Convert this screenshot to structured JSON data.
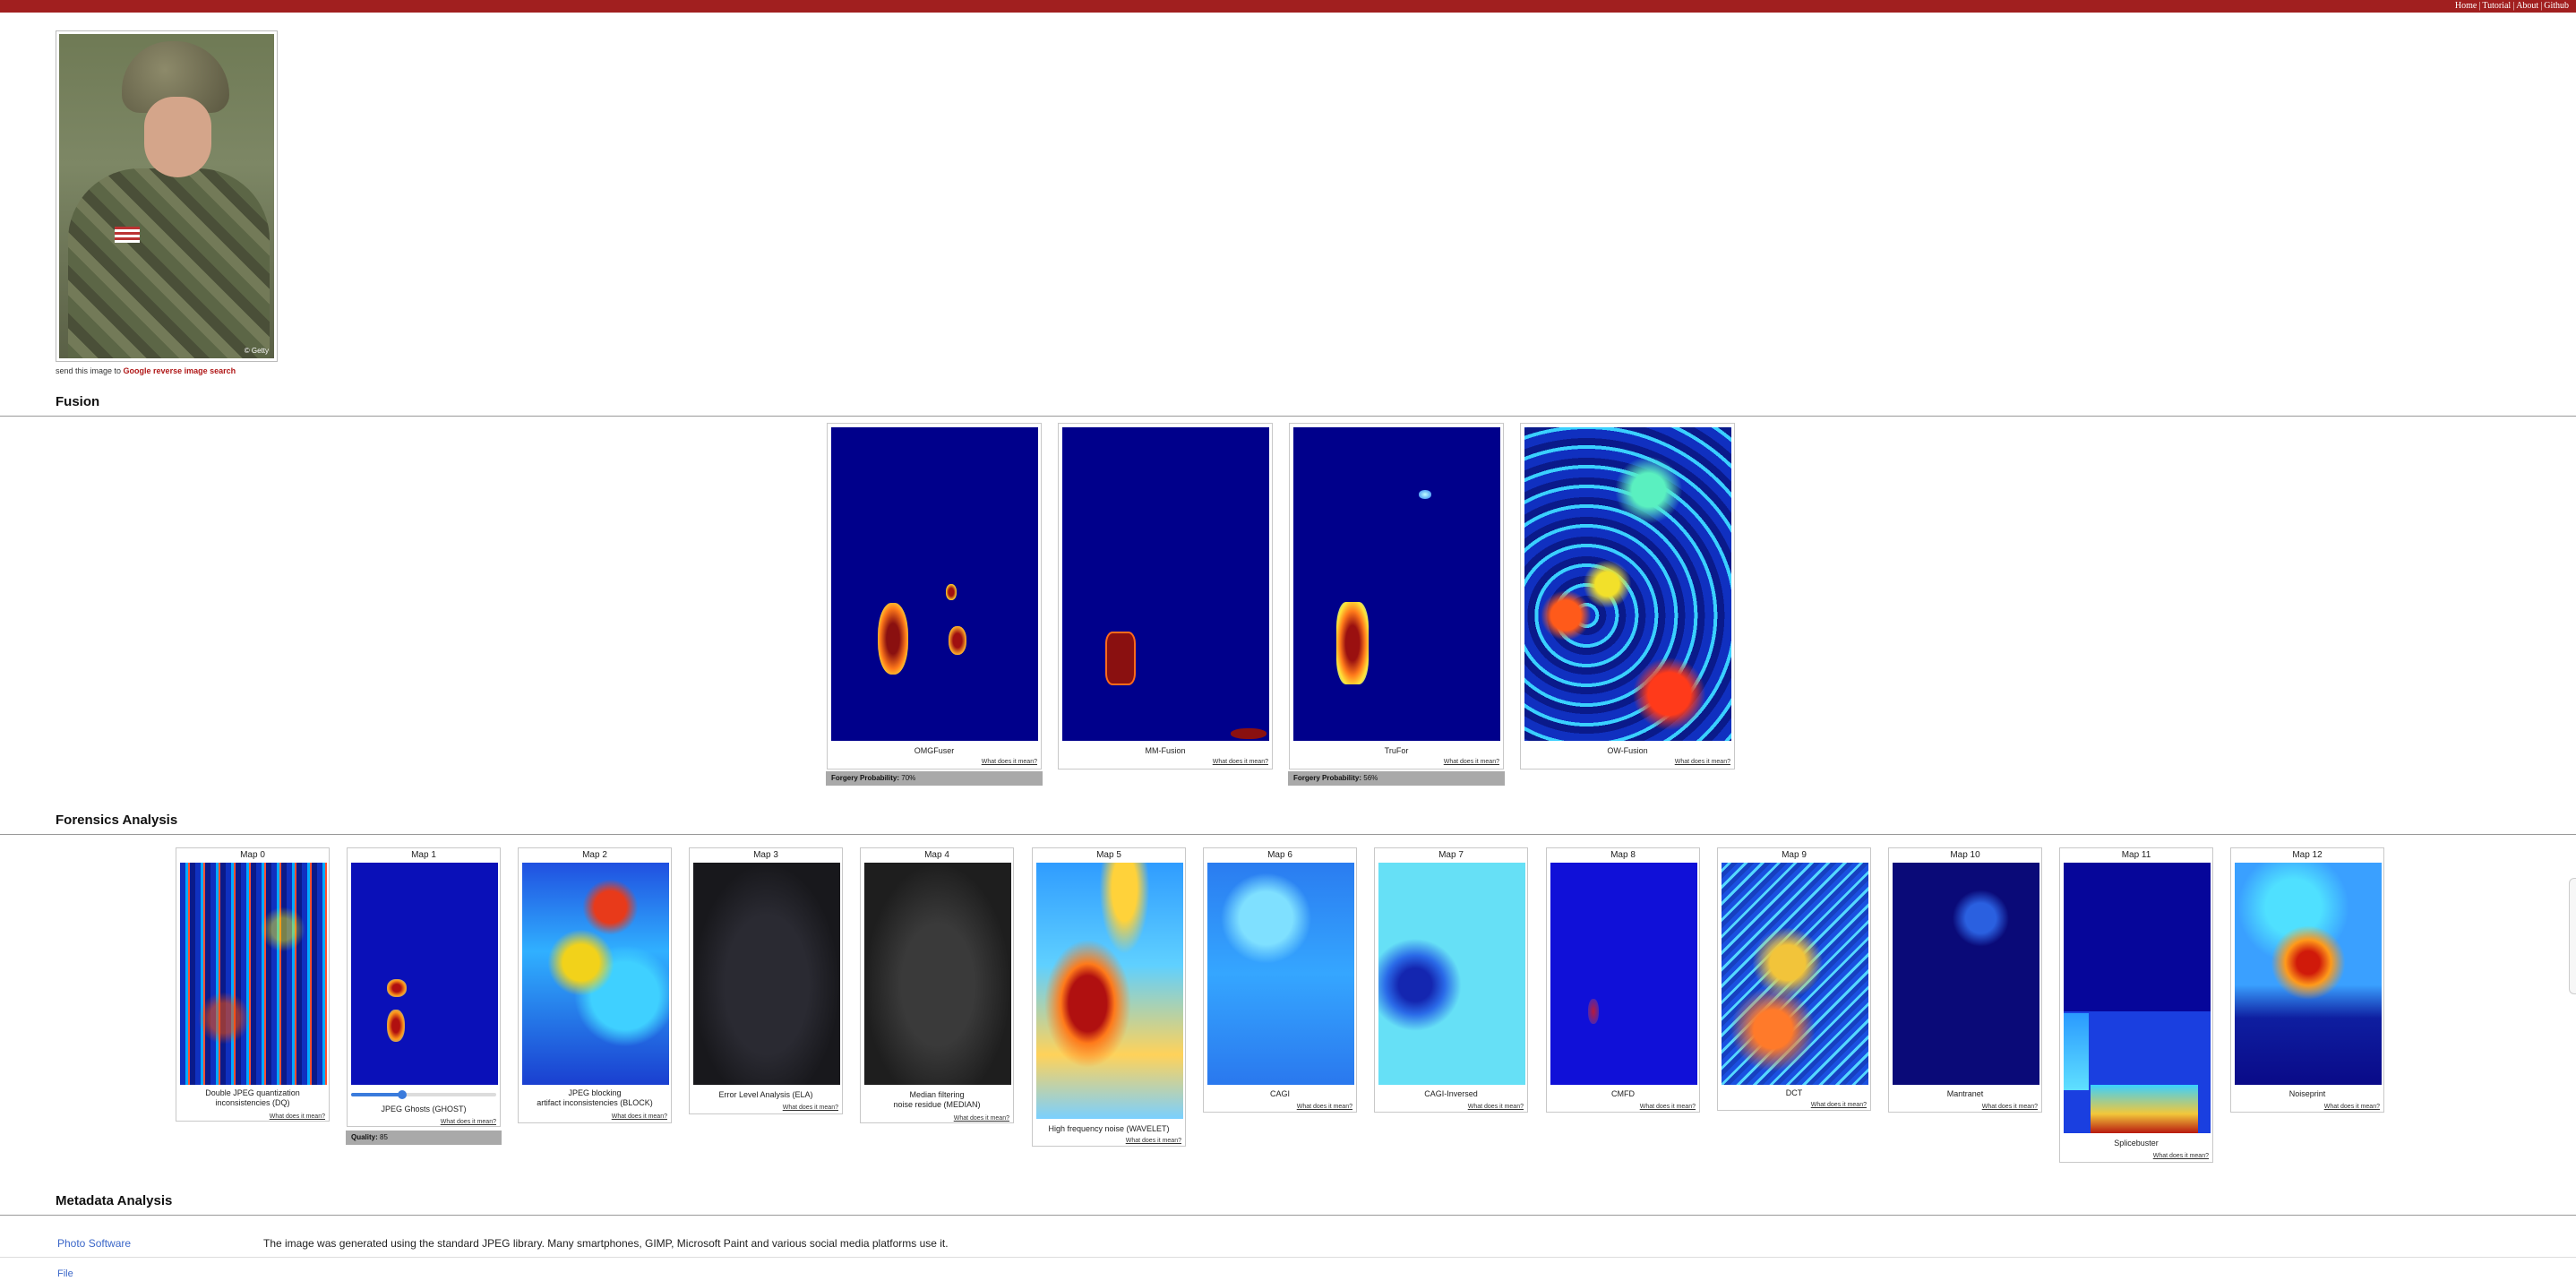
{
  "nav": {
    "links": [
      "Home",
      "Tutorial",
      "About",
      "Github"
    ],
    "separator": "|"
  },
  "photo": {
    "watermark": "© Getty"
  },
  "send": {
    "prefix": "send this image to ",
    "link": "Google reverse image search"
  },
  "fusion": {
    "title": "Fusion",
    "cards": [
      {
        "label": "OMGFuser",
        "what": "What does it mean?",
        "probability_label": "Forgery Probability:",
        "probability": "70%"
      },
      {
        "label": "MM-Fusion",
        "what": "What does it mean?"
      },
      {
        "label": "TruFor",
        "what": "What does it mean?",
        "probability_label": "Forgery Probability:",
        "probability": "56%"
      },
      {
        "label": "OW-Fusion",
        "what": "What does it mean?"
      }
    ]
  },
  "forensics": {
    "title": "Forensics Analysis",
    "maps": [
      {
        "map": "Map 0",
        "caption": "Double JPEG quantization\ninconsistencies (DQ)",
        "what": "What does it mean?"
      },
      {
        "map": "Map 1",
        "caption": "JPEG Ghosts (GHOST)",
        "what": "What does it mean?",
        "quality_label": "Quality:",
        "quality": "85",
        "slider_fraction": 0.35
      },
      {
        "map": "Map 2",
        "caption": "JPEG blocking\nartifact inconsistencies (BLOCK)",
        "what": "What does it mean?"
      },
      {
        "map": "Map 3",
        "caption": "Error Level Analysis (ELA)",
        "what": "What does it mean?"
      },
      {
        "map": "Map 4",
        "caption": "Median filtering\nnoise residue (MEDIAN)",
        "what": "What does it mean?"
      },
      {
        "map": "Map 5",
        "caption": "High frequency noise (WAVELET)",
        "what": "What does it mean?"
      },
      {
        "map": "Map 6",
        "caption": "CAGI",
        "what": "What does it mean?"
      },
      {
        "map": "Map 7",
        "caption": "CAGI-Inversed",
        "what": "What does it mean?"
      },
      {
        "map": "Map 8",
        "caption": "CMFD",
        "what": "What does it mean?"
      },
      {
        "map": "Map 9",
        "caption": "DCT",
        "what": "What does it mean?"
      },
      {
        "map": "Map 10",
        "caption": "Mantranet",
        "what": "What does it mean?"
      },
      {
        "map": "Map 11",
        "caption": "Splicebuster",
        "what": "What does it mean?"
      },
      {
        "map": "Map 12",
        "caption": "Noiseprint",
        "what": "What does it mean?"
      }
    ]
  },
  "metadata": {
    "title": "Metadata Analysis",
    "rows": [
      {
        "label": "Photo Software",
        "value": "The image was generated using the standard JPEG library. Many smartphones, GIMP, Microsoft Paint and various social media platforms use it."
      },
      {
        "label": "File",
        "value": ""
      }
    ]
  },
  "colors": {
    "topbar": "#a11f1f",
    "link_red": "#b01818",
    "meta_link": "#3a66c8",
    "slider": "#3a7bdc"
  }
}
